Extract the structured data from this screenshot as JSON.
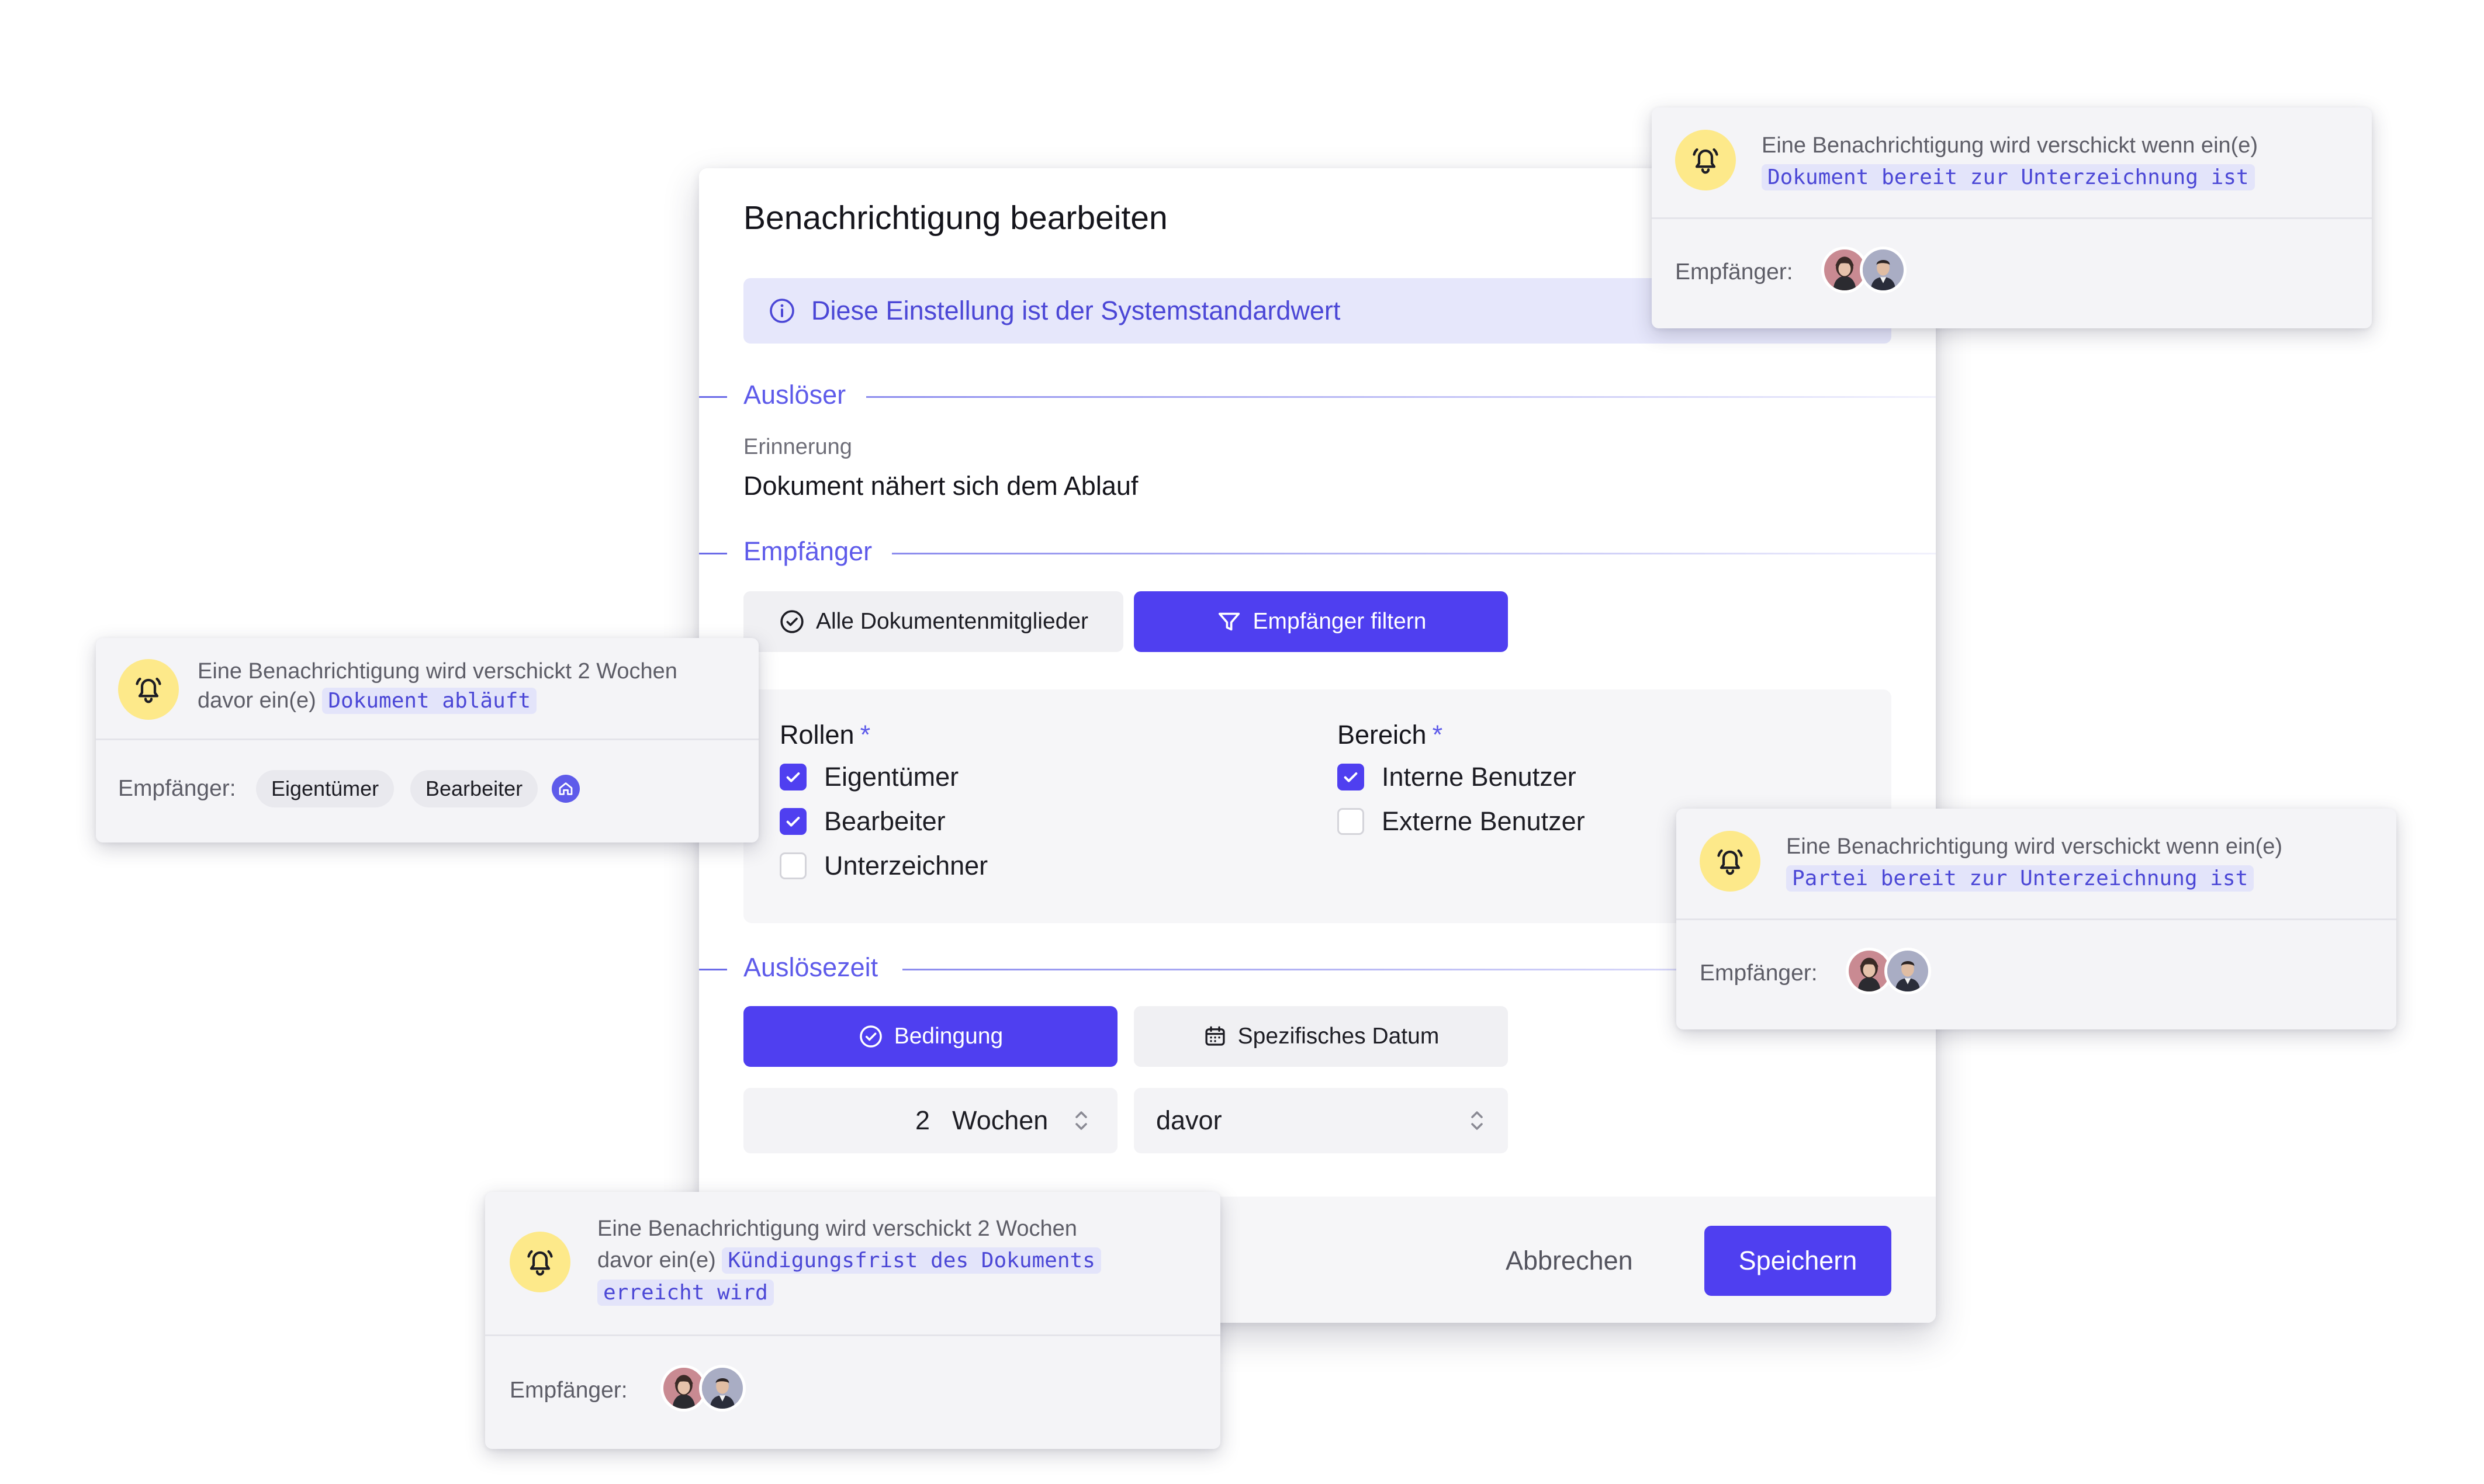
{
  "dialog": {
    "title": "Benachrichtigung bearbeiten",
    "info_banner": "Diese Einstellung ist der Systemstandardwert",
    "trigger": {
      "section_label": "Auslöser",
      "caption": "Erinnerung",
      "value": "Dokument nähert sich dem Ablauf"
    },
    "recipients": {
      "section_label": "Empfänger",
      "all_members_label": "Alle Dokumentenmitglieder",
      "filter_label": "Empfänger filtern",
      "roles": {
        "heading": "Rollen",
        "required_mark": "*",
        "items": [
          {
            "label": "Eigentümer",
            "checked": true
          },
          {
            "label": "Bearbeiter",
            "checked": true
          },
          {
            "label": "Unterzeichner",
            "checked": false
          }
        ]
      },
      "scope": {
        "heading": "Bereich",
        "required_mark": "*",
        "items": [
          {
            "label": "Interne Benutzer",
            "checked": true
          },
          {
            "label": "Externe Benutzer",
            "checked": false
          }
        ]
      }
    },
    "trigger_time": {
      "section_label": "Auslösezeit",
      "condition_label": "Bedingung",
      "specific_date_label": "Spezifisches Datum",
      "amount": "2",
      "unit": "Wochen",
      "relation": "davor"
    },
    "footer": {
      "cancel_label": "Abbrechen",
      "save_label": "Speichern"
    }
  },
  "cards": {
    "top_right": {
      "prefix": "Eine Benachrichtigung wird verschickt wenn ein(e)",
      "code": "Dokument bereit zur Unterzeichnung ist",
      "recipients_label": "Empfänger:"
    },
    "left": {
      "prefix_line1": "Eine Benachrichtigung wird verschickt 2 Wochen",
      "prefix_line2": "davor ein(e)",
      "code": "Dokument abläuft",
      "recipients_label": "Empfänger:",
      "chips": [
        "Eigentümer",
        "Bearbeiter"
      ]
    },
    "right_middle": {
      "prefix": "Eine Benachrichtigung wird verschickt wenn ein(e)",
      "code": "Partei bereit zur Unterzeichnung ist",
      "recipients_label": "Empfänger:"
    },
    "bottom": {
      "prefix_line1": "Eine Benachrichtigung wird verschickt 2 Wochen",
      "prefix_line2": "davor ein(e)",
      "code_line1": "Kündigungsfrist des Dokuments",
      "code_line2": "erreicht wird",
      "recipients_label": "Empfänger:"
    }
  },
  "colors": {
    "accent": "#4f3ff0",
    "accent_text": "#5e5bea",
    "banner_bg": "#e6e7fb",
    "bell_bg": "#fde98a"
  },
  "icons": [
    "info-icon",
    "check-circle-icon",
    "filter-icon",
    "calendar-icon",
    "chevron-updown-icon",
    "bell-icon",
    "home-icon"
  ]
}
